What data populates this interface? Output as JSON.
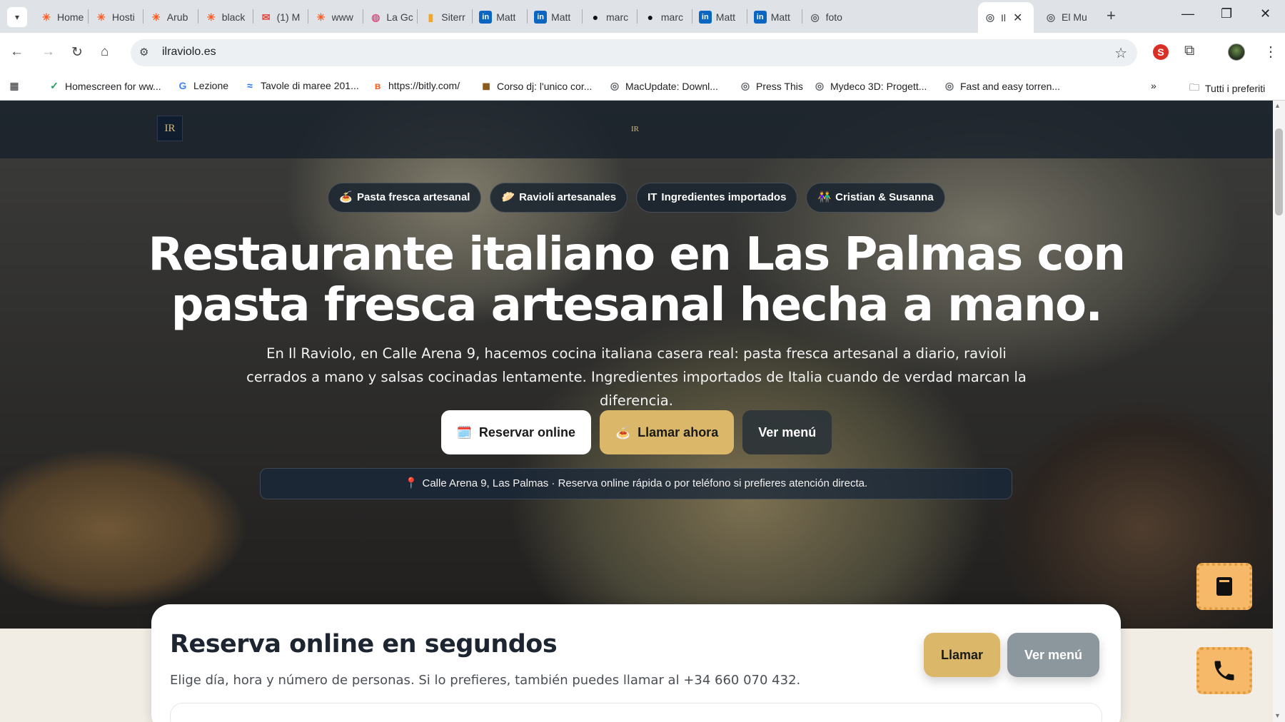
{
  "browser": {
    "tabs": [
      {
        "title": "Home",
        "icon": "plus-star",
        "icon_color": "#ff5a1f"
      },
      {
        "title": "Hosti",
        "icon": "plus-star",
        "icon_color": "#ff5a1f"
      },
      {
        "title": "Arub",
        "icon": "plus-star",
        "icon_color": "#ff5a1f"
      },
      {
        "title": "black",
        "icon": "plus-star",
        "icon_color": "#ff5a1f"
      },
      {
        "title": "(1) M",
        "icon": "mail",
        "icon_color": "#e8453c"
      },
      {
        "title": "www",
        "icon": "plus-star",
        "icon_color": "#ff5a1f"
      },
      {
        "title": "La Gc",
        "icon": "dribbble-ball",
        "icon_color": "#ea4c89"
      },
      {
        "title": "Siterr",
        "icon": "bar-chart",
        "icon_color": "#f5a623"
      },
      {
        "title": "Matt",
        "icon": "linkedin",
        "icon_color": "#0a66c2"
      },
      {
        "title": "Matt",
        "icon": "linkedin",
        "icon_color": "#0a66c2"
      },
      {
        "title": "marc",
        "icon": "github",
        "icon_color": "#111111"
      },
      {
        "title": "marc",
        "icon": "github",
        "icon_color": "#111111"
      },
      {
        "title": "Matt",
        "icon": "linkedin",
        "icon_color": "#0a66c2"
      },
      {
        "title": "Matt",
        "icon": "linkedin",
        "icon_color": "#0a66c2"
      },
      {
        "title": "foto",
        "icon": "globe",
        "icon_color": "#5f6368"
      },
      {
        "title": "Il",
        "icon": "globe",
        "icon_color": "#5f6368",
        "active": true
      },
      {
        "title": "El Mu",
        "icon": "globe",
        "icon_color": "#5f6368"
      }
    ],
    "url": "ilraviolo.es",
    "bookmarks": [
      {
        "label": "Homescreen for ww...",
        "icon": "check-mark"
      },
      {
        "label": "Lezione",
        "icon": "google-g"
      },
      {
        "label": "Tavole di maree 201...",
        "icon": "wave"
      },
      {
        "label": "https://bitly.com/",
        "icon": "bitly"
      },
      {
        "label": "Corso dj: l'unico cor...",
        "icon": "dj"
      },
      {
        "label": "MacUpdate: Downl...",
        "icon": "globe"
      },
      {
        "label": "Press This",
        "icon": "globe"
      },
      {
        "label": "Mydeco 3D: Progett...",
        "icon": "globe"
      },
      {
        "label": "Fast and easy torren...",
        "icon": "globe"
      }
    ],
    "bookmarks_overflow": "»",
    "all_bookmarks": "Tutti i preferiti"
  },
  "site": {
    "logo_text": "IR",
    "logo_center_text": "IR",
    "pills": [
      {
        "icon": "🍝",
        "label": "Pasta fresca artesanal"
      },
      {
        "icon": "🥟",
        "label": "Ravioli artesanales"
      },
      {
        "icon": "IT",
        "label": "Ingredientes importados"
      },
      {
        "icon": "👫",
        "label": "Cristian & Susanna"
      }
    ],
    "headline": "Restaurante italiano en Las Palmas con pasta fresca artesanal hecha a mano.",
    "lede": "En Il Raviolo, en Calle Arena 9, hacemos cocina italiana casera real: pasta fresca artesanal a diario, ravioli cerrados a mano y salsas cocinadas lentamente. Ingredientes importados de Italia cuando de verdad marcan la diferencia.",
    "cta": {
      "reserve_icon": "🗓️",
      "reserve": "Reservar online",
      "call_icon": "🍝",
      "call": "Llamar ahora",
      "menu": "Ver menú"
    },
    "address_pin": "📍",
    "address": "Calle Arena 9, Las Palmas · Reserva online rápida o por teléfono si prefieres atención directa.",
    "booking": {
      "title": "Reserva online en segundos",
      "subtitle": "Elige día, hora y número de personas. Si lo prefieres, también puedes llamar al +34 660 070 432.",
      "call_btn": "Llamar",
      "menu_btn": "Ver menú"
    }
  },
  "colors": {
    "gold": "#dbb76a",
    "fab": "#f5b969",
    "header": "#19212b"
  }
}
